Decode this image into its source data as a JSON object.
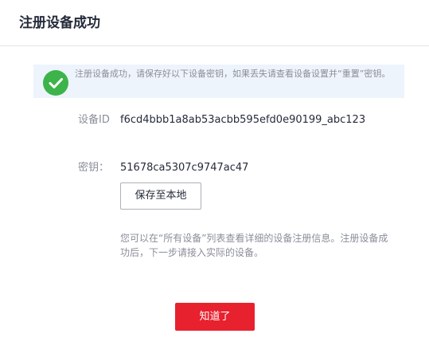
{
  "dialog": {
    "title": "注册设备成功"
  },
  "notice": {
    "icon": "check-circle-icon",
    "icon_color": "#3cb44a",
    "background": "#eef4fc",
    "text": "注册设备成功，请保存好以下设备密钥，如果丢失请查看设备设置并“重置”密钥。"
  },
  "device": {
    "id_label": "设备ID",
    "id_value": "f6cd4bbb1a8ab53acbb595efd0e90199_abc123",
    "key_label": "密钥：",
    "key_value": "51678ca5307c9747ac47"
  },
  "actions": {
    "save_local_label": "保存至本地",
    "ok_label": "知道了",
    "ok_color": "#e8212f"
  },
  "help": {
    "text": "您可以在“所有设备”列表查看详细的设备注册信息。注册设备成功后，下一步请接入实际的设备。"
  }
}
